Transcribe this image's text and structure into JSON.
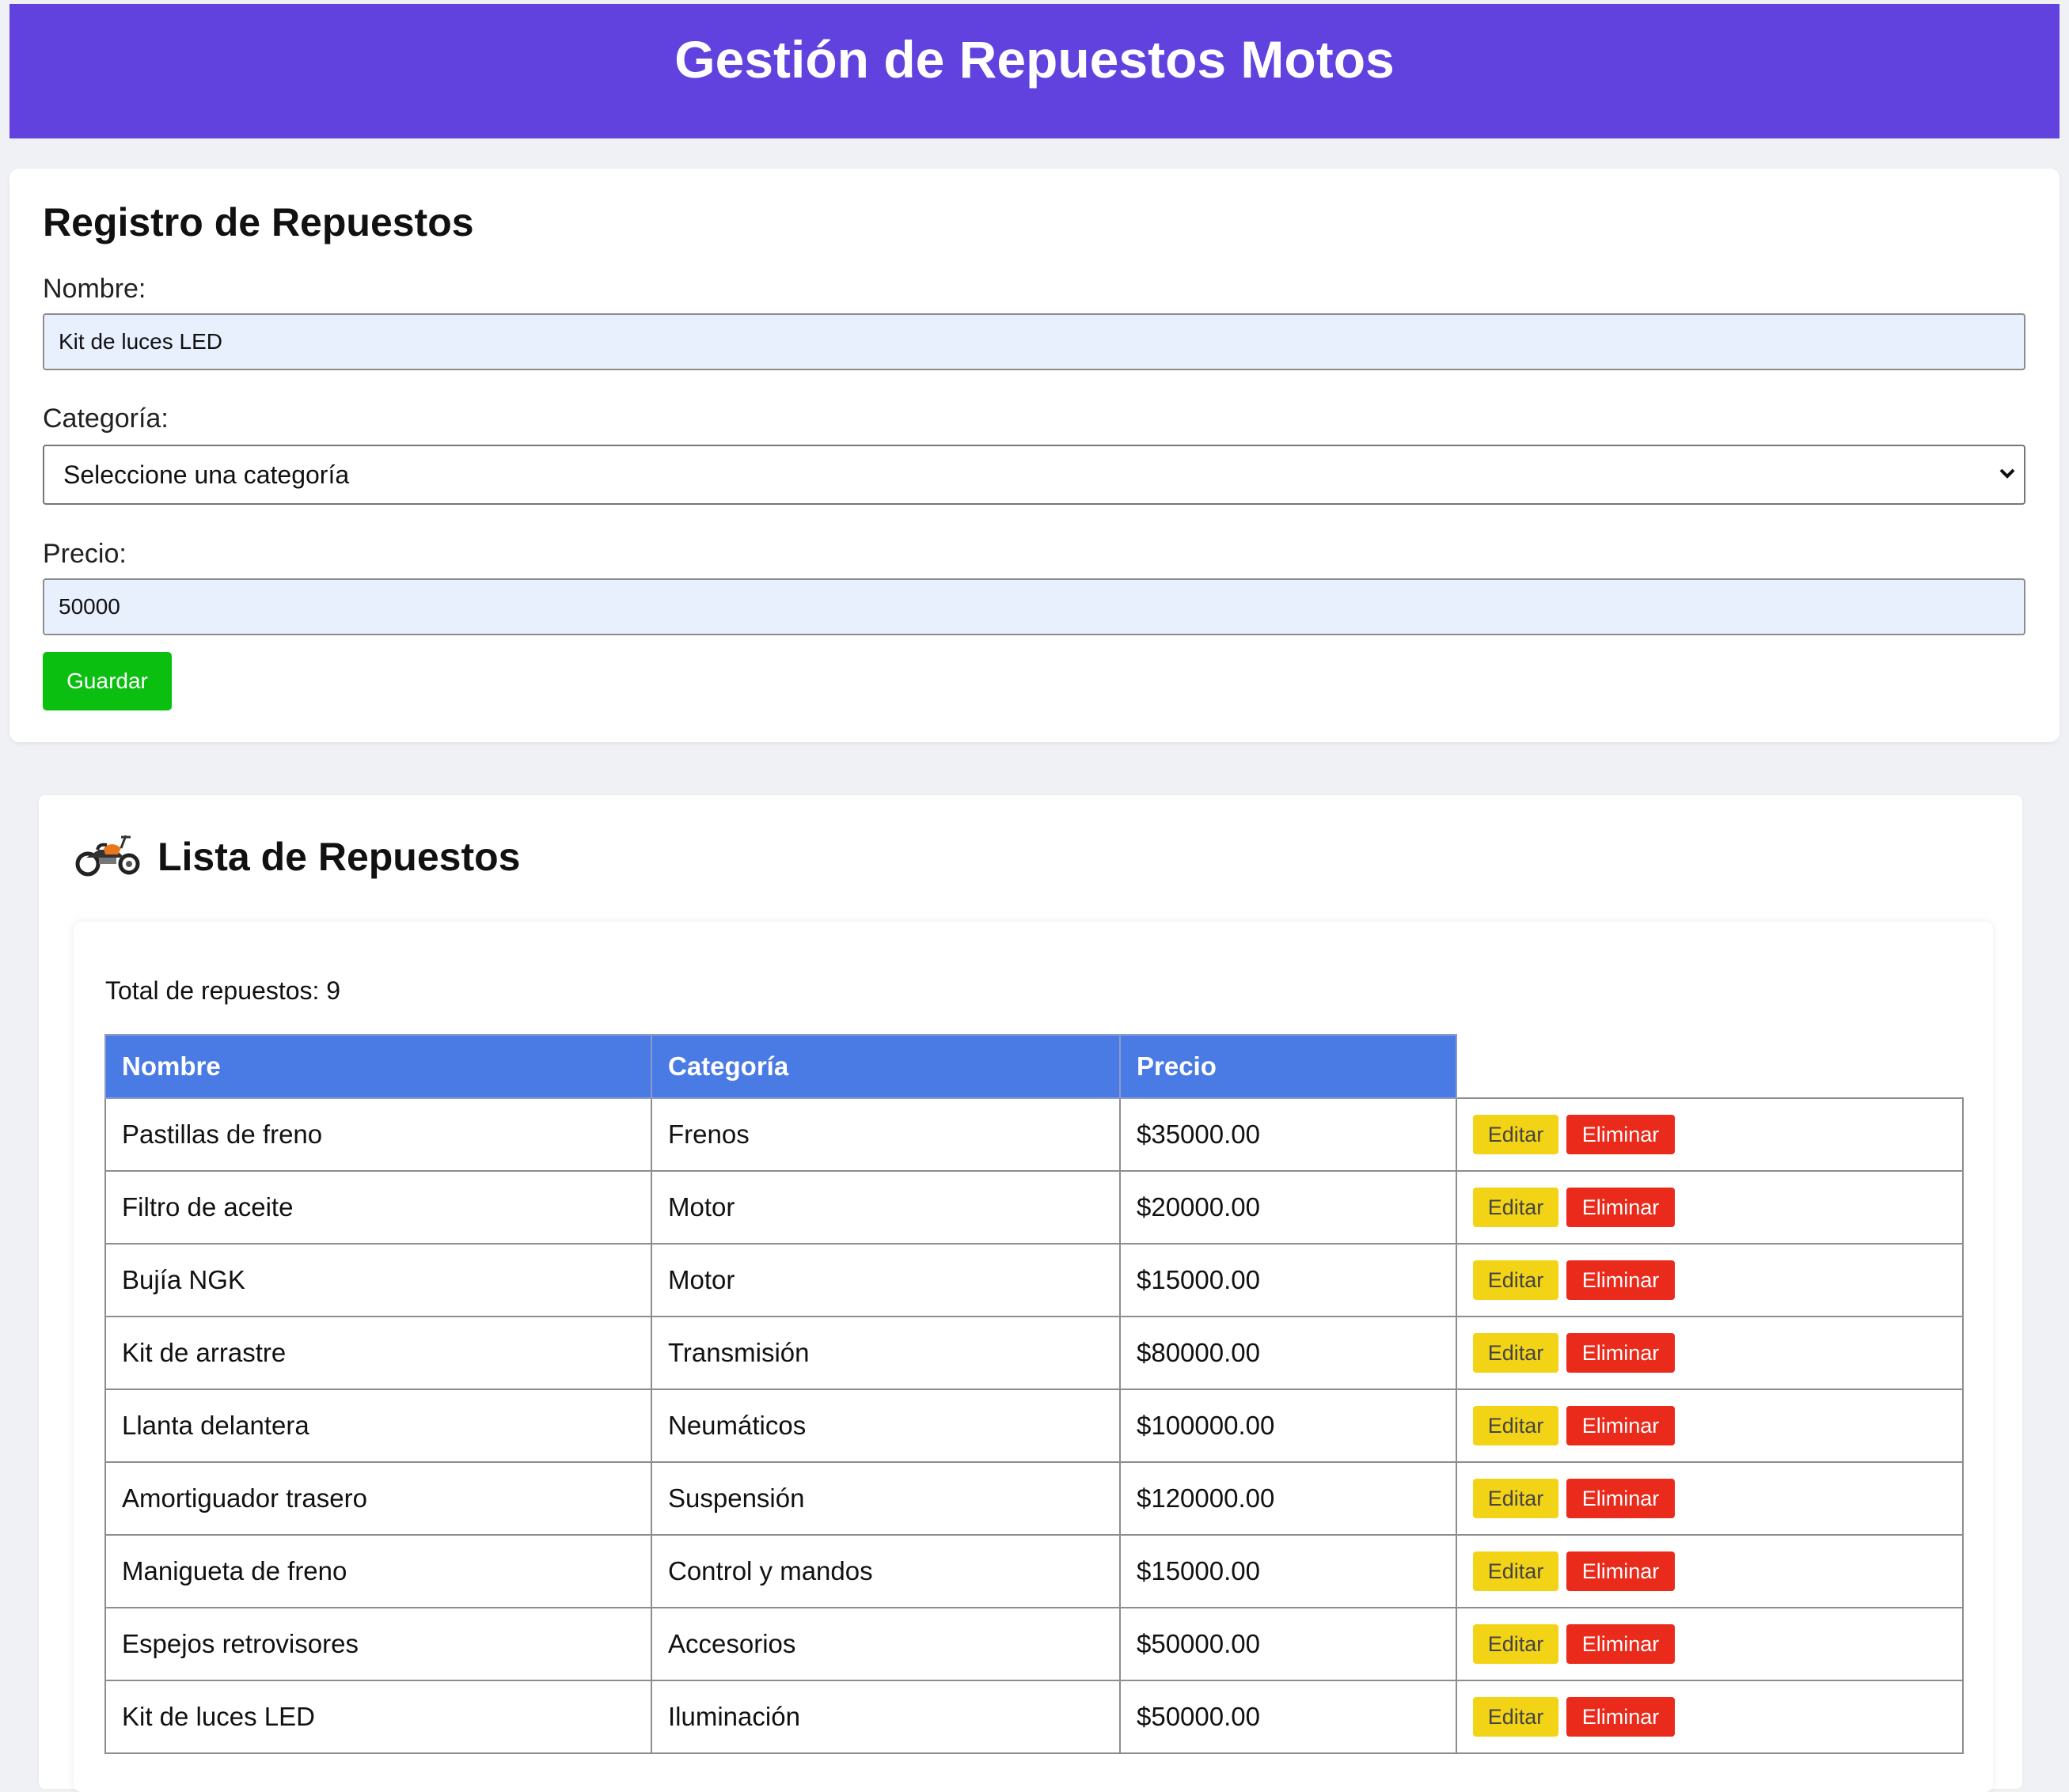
{
  "header": {
    "title": "Gestión de Repuestos Motos"
  },
  "form": {
    "title": "Registro de Repuestos",
    "nombre_label": "Nombre:",
    "nombre_value": "Kit de luces LED",
    "categoria_label": "Categoría:",
    "categoria_value": "Seleccione una categoría",
    "precio_label": "Precio:",
    "precio_value": "50000",
    "save_label": "Guardar"
  },
  "list": {
    "icon": "motorcycle-icon",
    "title": "Lista de Repuestos",
    "total_text": "Total de repuestos: 9",
    "columns": [
      "Nombre",
      "Categoría",
      "Precio"
    ],
    "edit_label": "Editar",
    "delete_label": "Eliminar",
    "rows": [
      {
        "nombre": "Pastillas de freno",
        "categoria": "Frenos",
        "precio": "$35000.00"
      },
      {
        "nombre": "Filtro de aceite",
        "categoria": "Motor",
        "precio": "$20000.00"
      },
      {
        "nombre": "Bujía NGK",
        "categoria": "Motor",
        "precio": "$15000.00"
      },
      {
        "nombre": "Kit de arrastre",
        "categoria": "Transmisión",
        "precio": "$80000.00"
      },
      {
        "nombre": "Llanta delantera",
        "categoria": "Neumáticos",
        "precio": "$100000.00"
      },
      {
        "nombre": "Amortiguador trasero",
        "categoria": "Suspensión",
        "precio": "$120000.00"
      },
      {
        "nombre": "Manigueta de freno",
        "categoria": "Control y mandos",
        "precio": "$15000.00"
      },
      {
        "nombre": "Espejos retrovisores",
        "categoria": "Accesorios",
        "precio": "$50000.00"
      },
      {
        "nombre": "Kit de luces LED",
        "categoria": "Iluminación",
        "precio": "$50000.00"
      }
    ]
  },
  "colors": {
    "header_bg": "#6142df",
    "table_header_bg": "#4a7be5",
    "save_button": "#0bbf11",
    "edit_button": "#f3d316",
    "delete_button": "#ea2a1b"
  }
}
